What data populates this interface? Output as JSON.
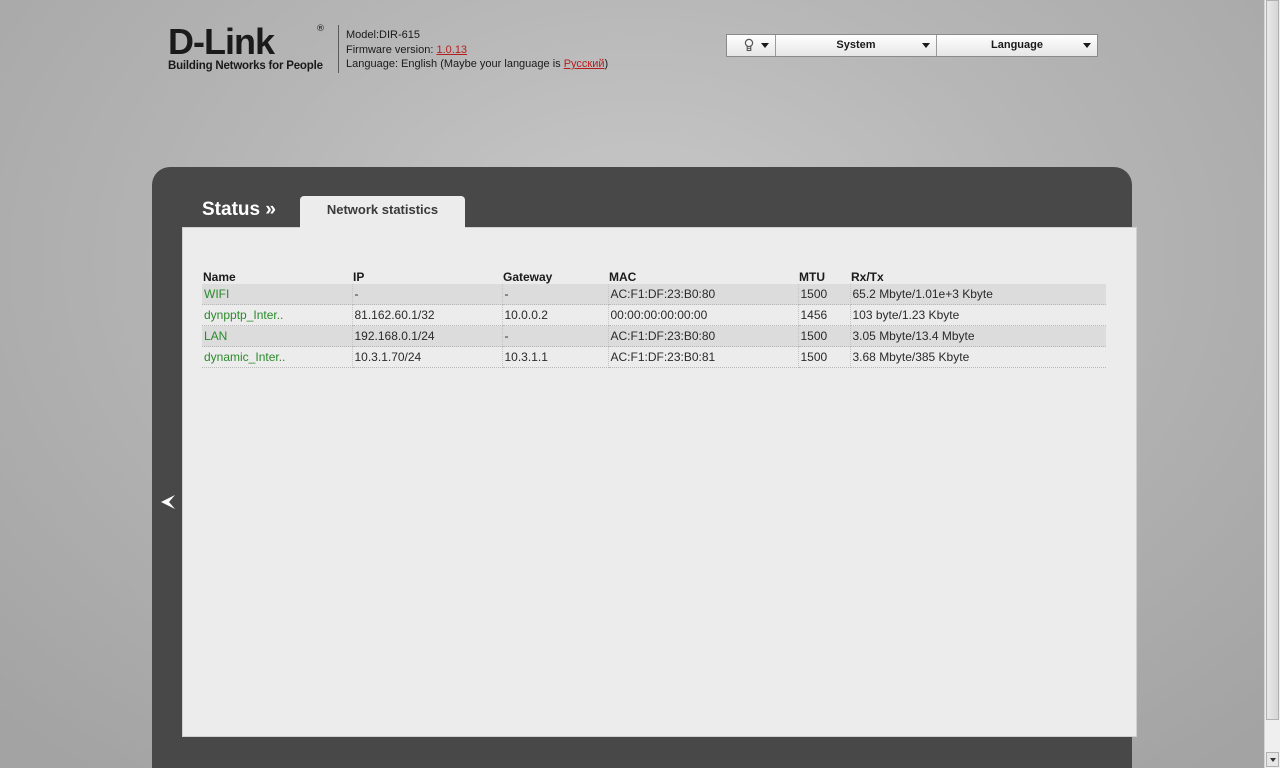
{
  "header": {
    "logo_text": "D-Link",
    "logo_registered": "®",
    "logo_tagline": "Building Networks for People",
    "model_line": "Model:DIR-615",
    "firmware_label": "Firmware version: ",
    "firmware_value": "1.0.13",
    "language_prefix": "Language: English (Maybe your language is ",
    "language_link": "Русский",
    "language_suffix": ")"
  },
  "topmenu": {
    "help_icon": "lightbulb-icon",
    "system_label": "System",
    "language_label": "Language"
  },
  "page": {
    "section_title": "Status »",
    "tab_label": "Network statistics",
    "back_icon": "chevron-left-icon"
  },
  "table": {
    "headers": [
      "Name",
      "IP",
      "Gateway",
      "MAC",
      "MTU",
      "Rx/Tx"
    ],
    "rows": [
      {
        "name": "WIFI",
        "ip": "-",
        "gateway": "-",
        "mac": "AC:F1:DF:23:B0:80",
        "mtu": "1500",
        "rxtx": "65.2 Mbyte/1.01e+3 Kbyte"
      },
      {
        "name": "dynpptp_Inter..",
        "ip": "81.162.60.1/32",
        "gateway": "10.0.0.2",
        "mac": "00:00:00:00:00:00",
        "mtu": "1456",
        "rxtx": "103 byte/1.23 Kbyte"
      },
      {
        "name": "LAN",
        "ip": "192.168.0.1/24",
        "gateway": "-",
        "mac": "AC:F1:DF:23:B0:80",
        "mtu": "1500",
        "rxtx": "3.05 Mbyte/13.4 Mbyte"
      },
      {
        "name": "dynamic_Inter..",
        "ip": "10.3.1.70/24",
        "gateway": "10.3.1.1",
        "mac": "AC:F1:DF:23:B0:81",
        "mtu": "1500",
        "rxtx": "3.68 Mbyte/385 Kbyte"
      }
    ]
  },
  "colors": {
    "link_green": "#2a8a2a",
    "link_red": "#b51e1e",
    "panel_dark": "#484848"
  }
}
